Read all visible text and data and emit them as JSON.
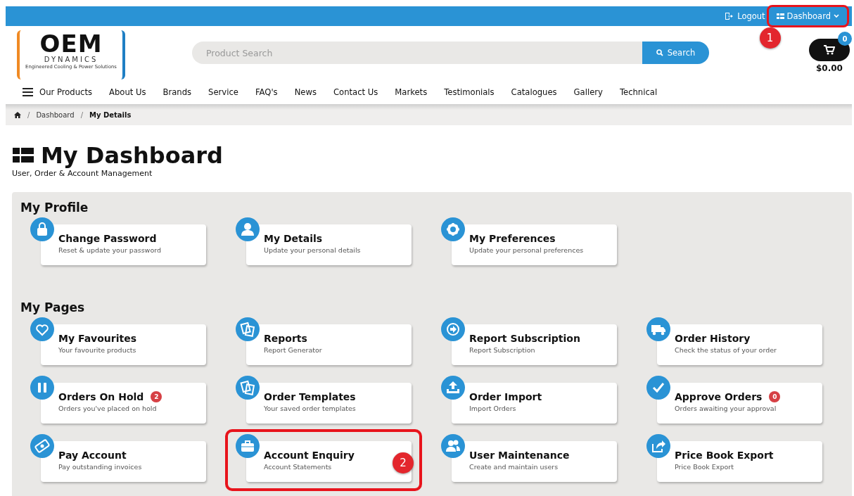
{
  "top_bar": {
    "logout": "Logout",
    "dashboard_button": {
      "label": "Dashboard",
      "highlighted": true,
      "marker": "1"
    }
  },
  "logo": {
    "word": "OEM",
    "subword": "DYNAMICS",
    "tagline": "Engineered Cooling & Power Solutions"
  },
  "search": {
    "placeholder": "Product Search",
    "button": "Search"
  },
  "cart": {
    "count": "0",
    "total": "$0.00"
  },
  "nav": {
    "items": [
      "Our Products",
      "About Us",
      "Brands",
      "Service",
      "FAQ's",
      "News",
      "Contact Us",
      "Markets",
      "Testimonials",
      "Catalogues",
      "Gallery",
      "Technical"
    ]
  },
  "breadcrumb": [
    {
      "label": "Dashboard",
      "separator": "/",
      "current": false
    },
    {
      "label": "My Details",
      "separator": "/",
      "current": true
    }
  ],
  "page": {
    "title": "My Dashboard",
    "subtitle": "User, Order & Account Management"
  },
  "sections": [
    {
      "title": "My Profile",
      "tiles": [
        {
          "title": "Change Password",
          "subtitle": "Reset & update your password"
        },
        {
          "title": "My Details",
          "subtitle": "Update your personal details"
        },
        {
          "title": "My Preferences",
          "subtitle": "Update your personal preferences"
        }
      ]
    },
    {
      "title": "My Pages",
      "tiles": [
        {
          "title": "My Favourites",
          "subtitle": "Your favourite products"
        },
        {
          "title": "Reports",
          "subtitle": "Report Generator"
        },
        {
          "title": "Report Subscription",
          "subtitle": "Report Subscription"
        },
        {
          "title": "Order History",
          "subtitle": "Check the status of your order"
        },
        {
          "title": "Orders On Hold",
          "subtitle": "Orders you've placed on hold",
          "badge": "2"
        },
        {
          "title": "Order Templates",
          "subtitle": "Your saved order templates"
        },
        {
          "title": "Order Import",
          "subtitle": "Import Orders"
        },
        {
          "title": "Approve Orders",
          "subtitle": "Orders awaiting your approval",
          "badge": "0"
        },
        {
          "title": "Pay Account",
          "subtitle": "Pay outstanding invoices"
        },
        {
          "title": "Account Enquiry",
          "subtitle": "Account Statements",
          "highlighted": true,
          "marker": "2"
        },
        {
          "title": "User Maintenance",
          "subtitle": "Create and maintain users"
        },
        {
          "title": "Price Book Export",
          "subtitle": "Price Book Export"
        }
      ]
    }
  ]
}
